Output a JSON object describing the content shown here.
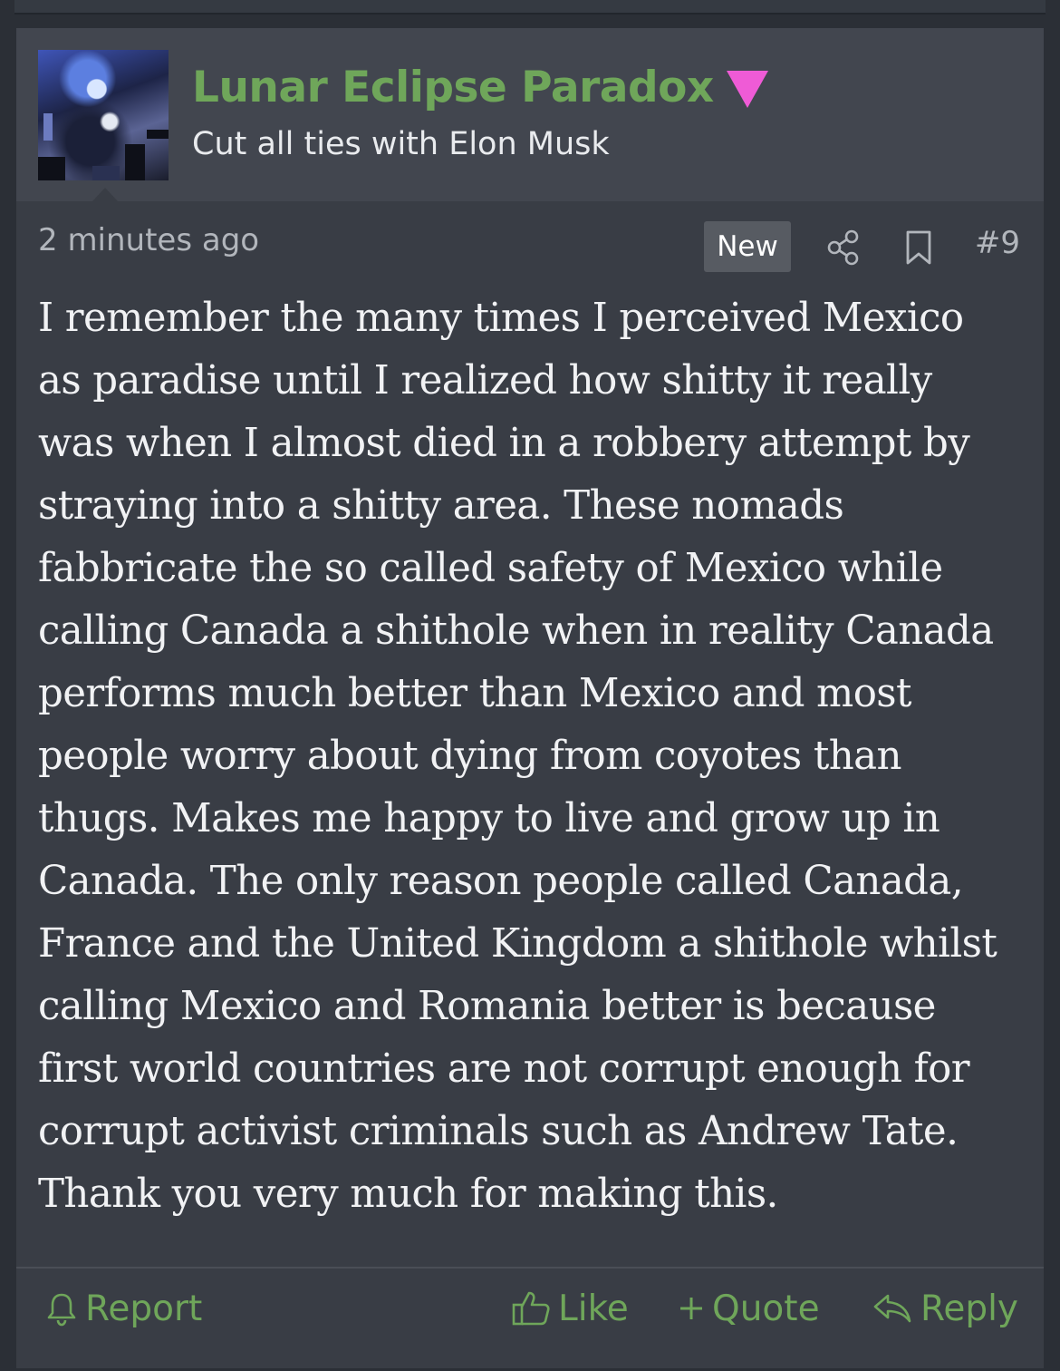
{
  "colors": {
    "accent": "#6fa65a",
    "badge": "#ef5bd6",
    "background": "#2b2f36",
    "post_bg": "#393d45",
    "header_bg": "#42464f"
  },
  "user": {
    "name": "Lunar Eclipse Paradox",
    "title": "Cut all ties with Elon Musk",
    "avatar_icon": "anime-avatar",
    "badge_icon": "pink-triangle-icon"
  },
  "meta": {
    "time": "2 minutes ago",
    "new_label": "New",
    "post_number": "#9"
  },
  "post": {
    "body": "I remember the many times I perceived Mexico\nas paradise until I realized how shitty it really\nwas when I almost died in a robbery attempt by\nstraying into a shitty area. These nomads\nfabbricate the so called safety of Mexico while\ncalling Canada a shithole when in reality Canada\nperforms much better than Mexico and most\npeople worry about dying from coyotes than\nthugs. Makes me happy to live and grow up in\nCanada. The only reason people called Canada,\nFrance and the United Kingdom a shithole whilst\ncalling Mexico and Romania better is because\nfirst world countries are not corrupt enough for\ncorrupt activist criminals such as Andrew Tate.\nThank you very much for making this."
  },
  "actions": {
    "report": "Report",
    "like": "Like",
    "quote": "Quote",
    "reply": "Reply"
  }
}
